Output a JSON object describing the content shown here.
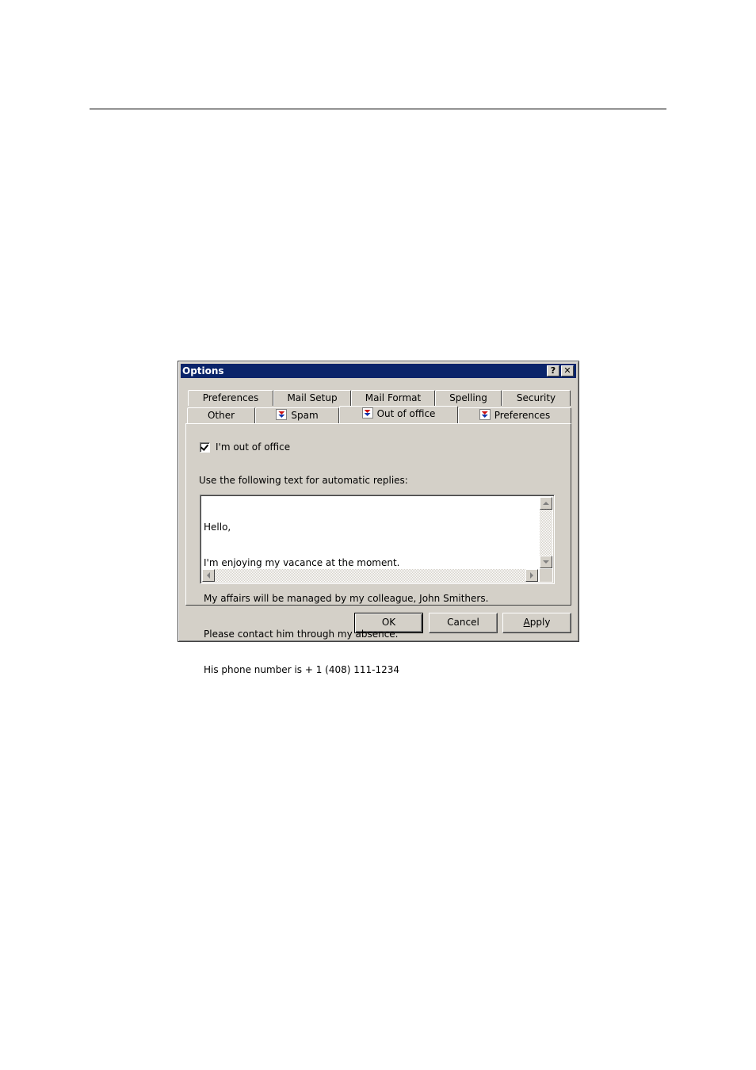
{
  "dialog": {
    "title": "Options",
    "help_label": "?",
    "close_label": "✕"
  },
  "tabs_row1": [
    {
      "label": "Preferences"
    },
    {
      "label": "Mail Setup"
    },
    {
      "label": "Mail Format"
    },
    {
      "label": "Spelling"
    },
    {
      "label": "Security"
    }
  ],
  "tabs_row2": [
    {
      "label": "Other"
    },
    {
      "label": "Spam",
      "icon": "plugin-icon"
    },
    {
      "label": "Out of office",
      "icon": "plugin-icon",
      "active": true
    },
    {
      "label": "Preferences",
      "icon": "plugin-icon"
    }
  ],
  "out_of_office": {
    "checkbox_label": "I'm out of office",
    "checked": true,
    "reply_label": "Use the following text for automatic replies:",
    "reply_lines": [
      "Hello,",
      "I'm enjoying my vacance at the moment.",
      "My affairs will be managed by my colleague, John Smithers.",
      "Please contact him through my absence.",
      "His phone number is + 1 (408) 111-1234"
    ]
  },
  "buttons": {
    "ok": "OK",
    "cancel": "Cancel",
    "apply": "Apply"
  }
}
